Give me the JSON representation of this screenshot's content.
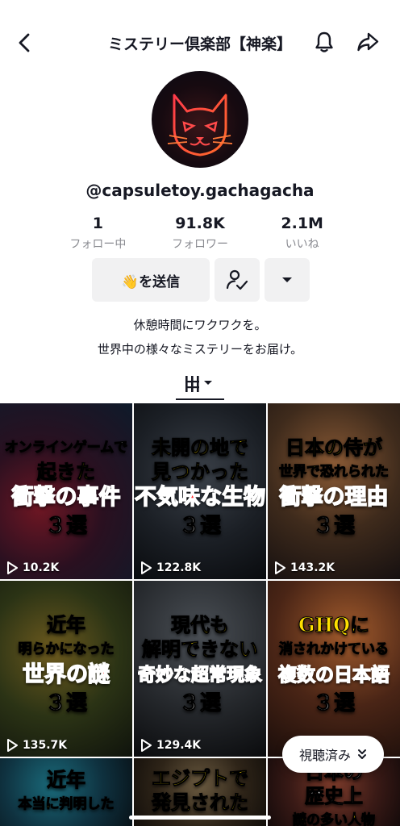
{
  "header": {
    "title": "ミステリー倶楽部【神楽】",
    "back_icon": "chevron-left-icon",
    "bell_icon": "bell-icon",
    "share_icon": "share-icon"
  },
  "profile": {
    "avatar_icon": "neon-cat-icon",
    "username": "@capsuletoy.gachagacha",
    "stats": [
      {
        "value": "1",
        "label": "フォロー中"
      },
      {
        "value": "91.8K",
        "label": "フォロワー"
      },
      {
        "value": "2.1M",
        "label": "いいね"
      }
    ],
    "send_button": "👋を送信",
    "bio_lines": [
      "休憩時間にワクワクを。",
      "世界中の様々なミステリーをお届け。"
    ]
  },
  "tabs": {
    "active_icon": "videos-grid-icon"
  },
  "videos": [
    {
      "lines": [
        "オンラインゲームで",
        "起きた",
        "衝撃の事件",
        "３選"
      ],
      "views": "10.2K"
    },
    {
      "lines": [
        "未開の地で",
        "見つかった",
        "不気味な生物",
        "３選"
      ],
      "views": "122.8K"
    },
    {
      "lines": [
        "日本の侍が",
        "世界で恐れられた",
        "衝撃の理由",
        "３選"
      ],
      "views": "143.2K"
    },
    {
      "lines": [
        "近年",
        "明らかになった",
        "世界の謎",
        "３選"
      ],
      "views": "135.7K"
    },
    {
      "lines": [
        "現代も",
        "解明できない",
        "奇妙な超常現象",
        "３選"
      ],
      "views": "129.4K"
    },
    {
      "lines": [
        "GHQに",
        "消されかけている",
        "複数の日本語",
        "３選"
      ],
      "views": ""
    },
    {
      "lines": [
        "近年",
        "本当に判明した"
      ],
      "views": ""
    },
    {
      "lines": [
        "エジプトで",
        "発見された"
      ],
      "views": ""
    },
    {
      "lines": [
        "日本の",
        "歴史上",
        "謎の多い人物"
      ],
      "views": ""
    }
  ],
  "watched_pill": {
    "label": "視聴済み"
  },
  "colors": {
    "caption_yellow": "#ffe000",
    "caption_red": "#ff2a2a"
  }
}
